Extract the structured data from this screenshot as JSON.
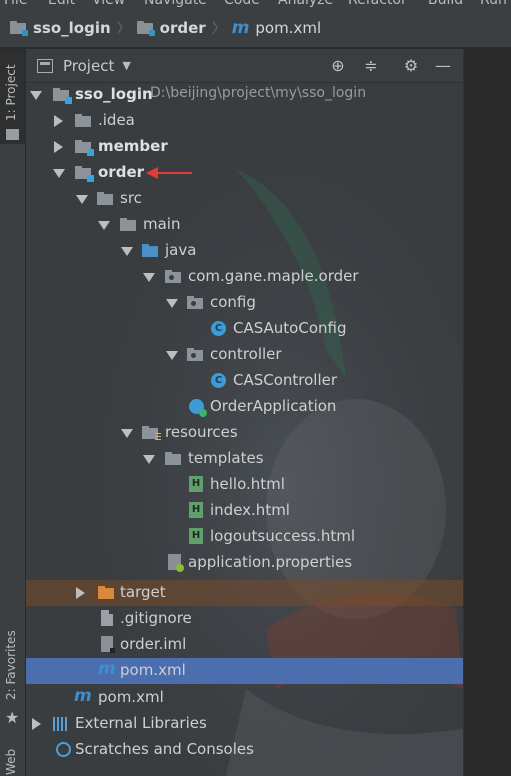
{
  "menu": [
    "File",
    "Edit",
    "View",
    "Navigate",
    "Code",
    "Analyze",
    "Refactor",
    "Build",
    "Run"
  ],
  "breadcrumb": [
    {
      "label": "sso_login",
      "icon": "module-folder-icon"
    },
    {
      "label": "order",
      "icon": "module-folder-icon"
    },
    {
      "label": "pom.xml",
      "icon": "maven-icon"
    }
  ],
  "left_strip": {
    "project_tab": "1: Project",
    "favorites_tab": "2: Favorites",
    "web_tab": "Web"
  },
  "panel": {
    "title": "Project",
    "dropdown_icon": "chevron-down-icon",
    "actions": [
      "locate-icon",
      "collapse-icon",
      "gear-icon",
      "minimize-icon"
    ]
  },
  "tree": [
    {
      "label": "sso_login",
      "path": "D:\\beijing\\project\\my\\sso_login",
      "bold": true,
      "icon": "module-folder",
      "expanded": true
    },
    {
      "label": ".idea",
      "icon": "folder",
      "expanded": false
    },
    {
      "label": "member",
      "bold": true,
      "icon": "module-folder",
      "expanded": false
    },
    {
      "label": "order",
      "bold": true,
      "icon": "module-folder",
      "expanded": true
    },
    {
      "label": "src",
      "icon": "folder",
      "expanded": true
    },
    {
      "label": "main",
      "icon": "folder",
      "expanded": true
    },
    {
      "label": "java",
      "icon": "source-folder",
      "expanded": true
    },
    {
      "label": "com.gane.maple.order",
      "icon": "package",
      "expanded": true
    },
    {
      "label": "config",
      "icon": "package",
      "expanded": true
    },
    {
      "label": "CASAutoConfig",
      "icon": "class"
    },
    {
      "label": "controller",
      "icon": "package",
      "expanded": true
    },
    {
      "label": "CASController",
      "icon": "class"
    },
    {
      "label": "OrderApplication",
      "icon": "spring-app"
    },
    {
      "label": "resources",
      "icon": "resources-folder",
      "expanded": true
    },
    {
      "label": "templates",
      "icon": "folder",
      "expanded": true
    },
    {
      "label": "hello.html",
      "icon": "html"
    },
    {
      "label": "index.html",
      "icon": "html"
    },
    {
      "label": "logoutsuccess.html",
      "icon": "html"
    },
    {
      "label": "application.properties",
      "icon": "properties"
    },
    {
      "label": "target",
      "icon": "excluded-folder",
      "expanded": false
    },
    {
      "label": ".gitignore",
      "icon": "file"
    },
    {
      "label": "order.iml",
      "icon": "iml"
    },
    {
      "label": "pom.xml",
      "icon": "maven",
      "selected": true
    },
    {
      "label": "pom.xml",
      "icon": "maven"
    },
    {
      "label": "External Libraries",
      "icon": "libraries",
      "expanded": false
    },
    {
      "label": "Scratches and Consoles",
      "icon": "scratches"
    }
  ],
  "colors": {
    "selection": "#4b6eaf",
    "annotation_arrow": "#e53935",
    "target_row": "#6b4a2a"
  }
}
